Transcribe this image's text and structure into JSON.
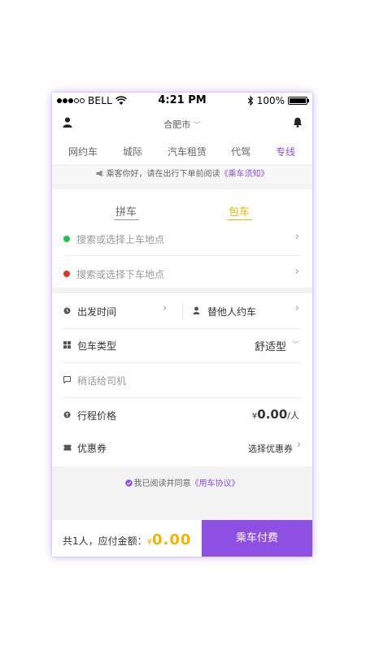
{
  "status_bar": {
    "carrier": "BELL",
    "time": "4:21 PM",
    "battery": "100%"
  },
  "header": {
    "city": "合肥市"
  },
  "tabs": [
    {
      "label": "网约车"
    },
    {
      "label": "城际"
    },
    {
      "label": "汽车租赁"
    },
    {
      "label": "代驾"
    },
    {
      "label": "专线",
      "active": true
    }
  ],
  "notice": {
    "text": "乘客你好，请在出行下单前阅读",
    "link": "《乘车须知》"
  },
  "mode_tabs": [
    {
      "label": "拼车"
    },
    {
      "label": "包车",
      "active": true
    }
  ],
  "route": {
    "pickup_placeholder": "搜索或选择上车地点",
    "dropoff_placeholder": "搜索或选择下车地点"
  },
  "form": {
    "departure_label": "出发时间",
    "book_for_others_label": "替他人约车",
    "charter_type_label": "包车类型",
    "charter_type_value": "舒适型",
    "message_placeholder": "稍话给司机",
    "price_label": "行程价格",
    "price_currency": "¥",
    "price_value": "0.00",
    "price_unit": "/人",
    "coupon_label": "优惠券",
    "coupon_action": "选择优惠券"
  },
  "agreement": {
    "text": "我已阅读并同意",
    "link": "《用车协议》"
  },
  "footer": {
    "total_label": "共1人，应付金额：",
    "currency": "¥",
    "amount": "0.00",
    "pay_button": "乘车付费"
  },
  "colors": {
    "accent": "#8e4fe3",
    "highlight": "#f1b400",
    "green_dot": "#22c14a",
    "red_dot": "#e8321a"
  }
}
